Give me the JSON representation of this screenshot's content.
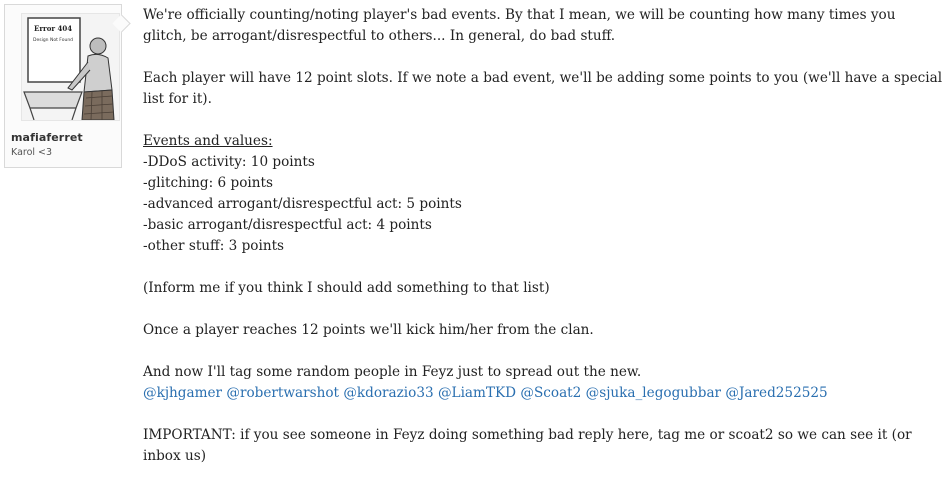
{
  "author": {
    "username": "mafiaferret",
    "user_title": "Karol <3",
    "avatar_text_line1": "Error 404",
    "avatar_text_line2": "Design Not Found"
  },
  "post": {
    "para1": "We're officially counting/noting player's bad events. By that I mean, we will be counting how many times you glitch, be arrogant/disrespectful to others... In general, do bad stuff.",
    "para2": "Each player will have 12 point slots. If we note a bad event, we'll be adding some points to you (we'll have a special list for it).",
    "events_heading": "Events and values:",
    "events": [
      "-DDoS activity: 10 points",
      "-glitching: 6 points",
      "-advanced arrogant/disrespectful act: 5 points",
      "-basic arrogant/disrespectful act: 4 points",
      "-other stuff: 3 points"
    ],
    "para3": "(Inform me if you think I should add something to that list)",
    "para4": "Once a player reaches 12 points we'll kick him/her from the clan.",
    "para5": "And now I'll tag some random people in Feyz just to spread out the new.",
    "mentions": [
      "@kjhgamer",
      "@robertwarshot",
      "@kdorazio33",
      "@LiamTKD",
      "@Scoat2",
      "@sjuka_legogubbar",
      "@Jared252525"
    ],
    "para6": "IMPORTANT: if you see someone in Feyz doing something bad reply here, tag me or scoat2 so we can see it (or inbox us)"
  },
  "colors": {
    "mention_link": "#2a6fb0",
    "body_text": "#222222",
    "card_border": "#d9d9d9"
  }
}
